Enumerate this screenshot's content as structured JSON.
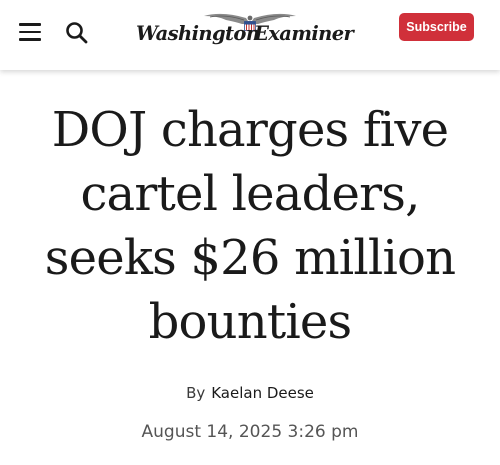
{
  "header": {
    "menu_icon": "hamburger-menu-icon",
    "search_icon": "search-icon",
    "logo": {
      "left_word": "Washington",
      "right_word": "Examiner",
      "emblem_icon": "eagle-icon"
    },
    "subscribe_label": "Subscribe",
    "subscribe_color": "#d0303a"
  },
  "article": {
    "headline": "DOJ charges five cartel leaders, seeks $26 million bounties",
    "byline_prefix": "By",
    "author": "Kaelan Deese",
    "date": "August 14, 2025 3:26 pm"
  }
}
